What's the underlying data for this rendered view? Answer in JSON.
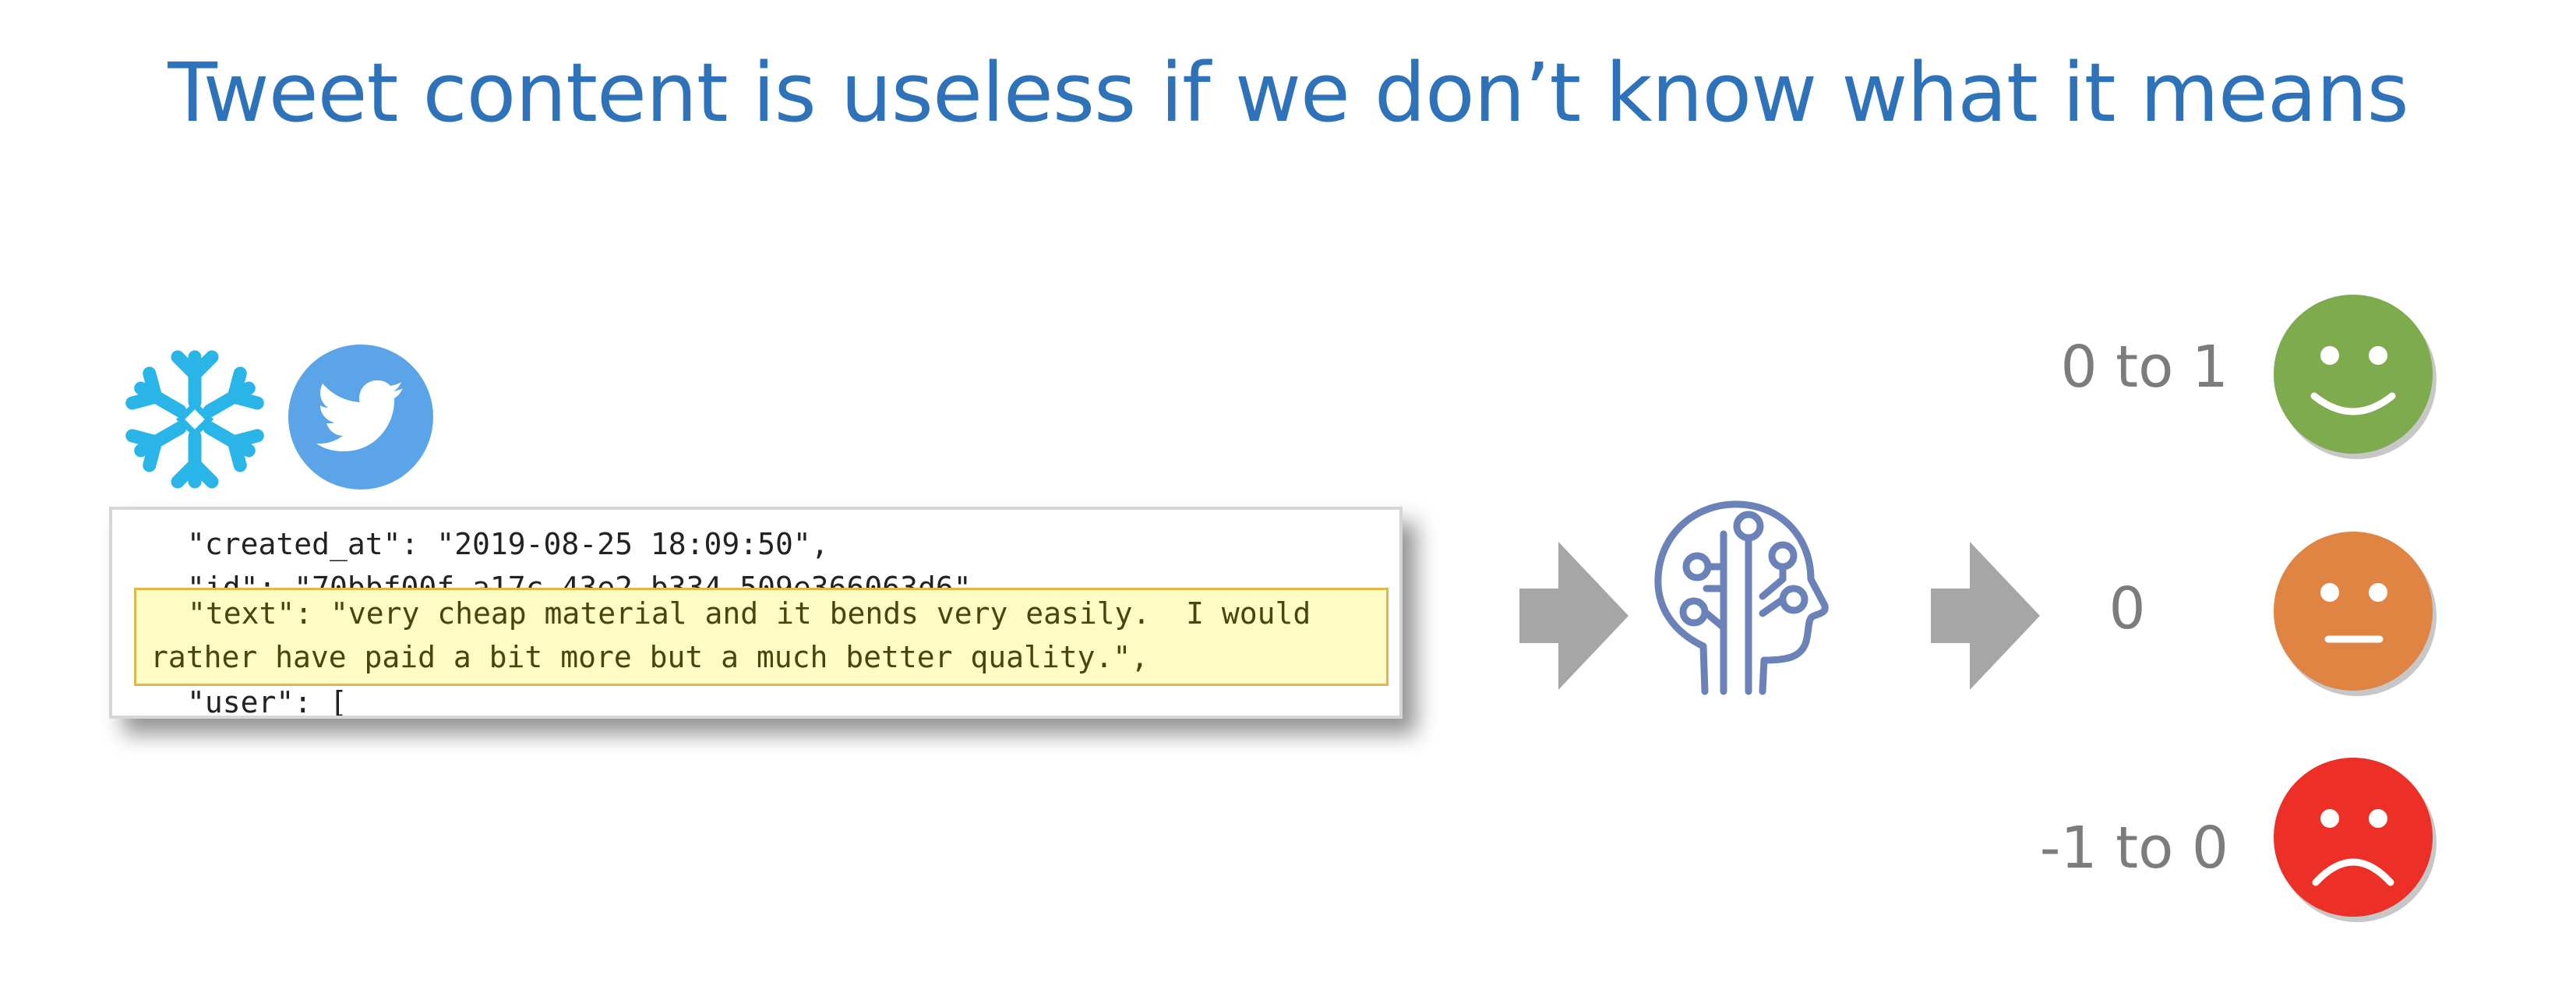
{
  "title": "Tweet content is useless if we don’t know what it means",
  "icons": {
    "snowflake": "snowflake-logo-icon",
    "twitter": "twitter-logo-icon",
    "brain": "ai-brain-icon",
    "happy": "happy-face-icon",
    "neutral": "neutral-face-icon",
    "sad": "sad-face-icon"
  },
  "colors": {
    "title": "#2e72b9",
    "snowflake": "#29b5e8",
    "twitter": "#5ba4e8",
    "arrow": "#a6a6a6",
    "brain": "#6b82b8",
    "happy": "#7eab4e",
    "neutral": "#e08443",
    "sad": "#ec3027",
    "score_text": "#7c7c7c",
    "highlight_bg": "#fffbc5",
    "highlight_border": "#e4b64a"
  },
  "json": {
    "line_created": "\"created_at\": \"2019-08-25 18:09:50\",",
    "line_id": "\"id\": \"70bbf00f-a17c-43e2-b334-509e366063d6\",",
    "line_text_1": "\"text\": \"very cheap material and it bends very easily.  I would",
    "line_text_2": "rather have paid a bit more but a much better quality.\",",
    "line_user": "\"user\": ["
  },
  "scores": {
    "positive": "0 to 1",
    "neutral": "0",
    "negative": "-1 to 0"
  }
}
